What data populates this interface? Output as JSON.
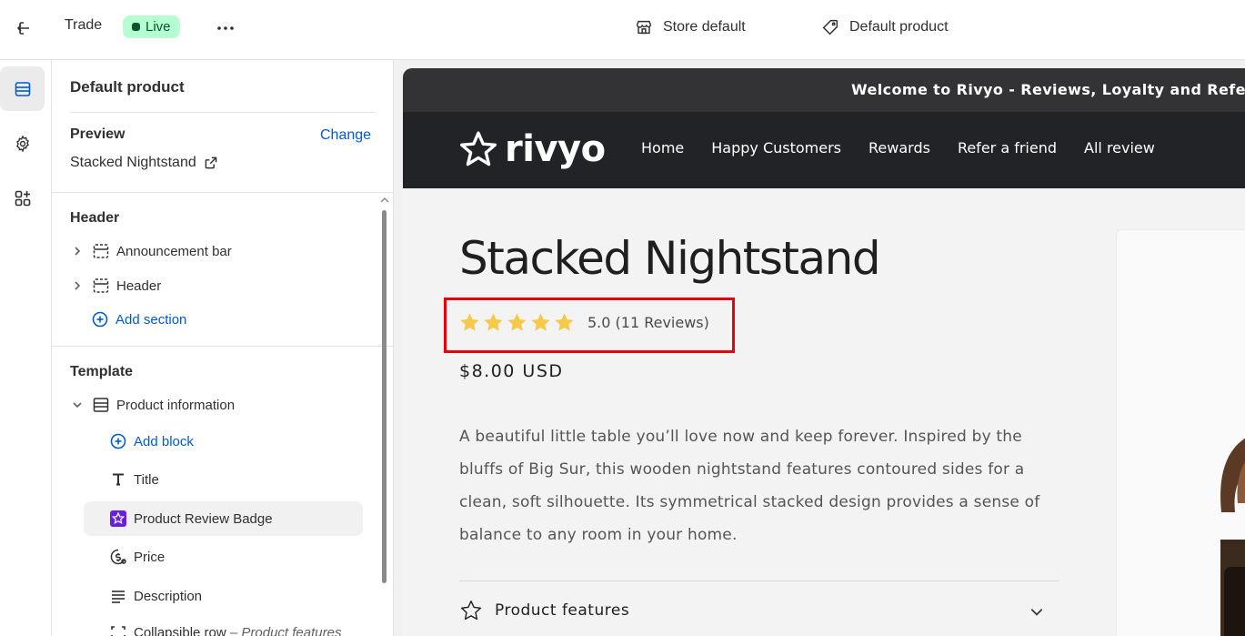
{
  "topbar": {
    "title": "Trade",
    "status": "Live",
    "store": "Store default",
    "template": "Default product"
  },
  "sidebar": {
    "heading": "Default product",
    "preview_label": "Preview",
    "change_link": "Change",
    "preview_product": "Stacked Nightstand",
    "header_label": "Header",
    "header_items": [
      "Announcement bar",
      "Header"
    ],
    "add_section": "Add section",
    "template_label": "Template",
    "section": "Product information",
    "add_block": "Add block",
    "blocks": [
      "Title",
      "Product Review Badge",
      "Price",
      "Description"
    ],
    "collapsible_row": "Collapsible row",
    "collapsible_row_detail": "– Product features"
  },
  "storefront": {
    "announcement": "Welcome to Rivyo - Reviews, Loyalty and Referrals",
    "logo_text": "rivyo",
    "nav": [
      "Home",
      "Happy Customers",
      "Rewards",
      "Refer a friend",
      "All review"
    ],
    "product_title": "Stacked Nightstand",
    "rating_stars": 5,
    "rating_text": "5.0 (11 Reviews)",
    "price": "$8.00 USD",
    "description": "A beautiful little table you’ll love now and keep forever. Inspired by the bluffs of Big Sur, this wooden nightstand features contoured sides for a clean, soft silhouette. Its symmetrical stacked design provides a sense of balance to any room in your home.",
    "features_label": "Product features"
  },
  "colors": {
    "accent_link": "#005bd3",
    "live_badge": "#b4fed2",
    "star": "#f7c948",
    "highlight_box": "#e8000b",
    "nav_bg": "#222326"
  }
}
